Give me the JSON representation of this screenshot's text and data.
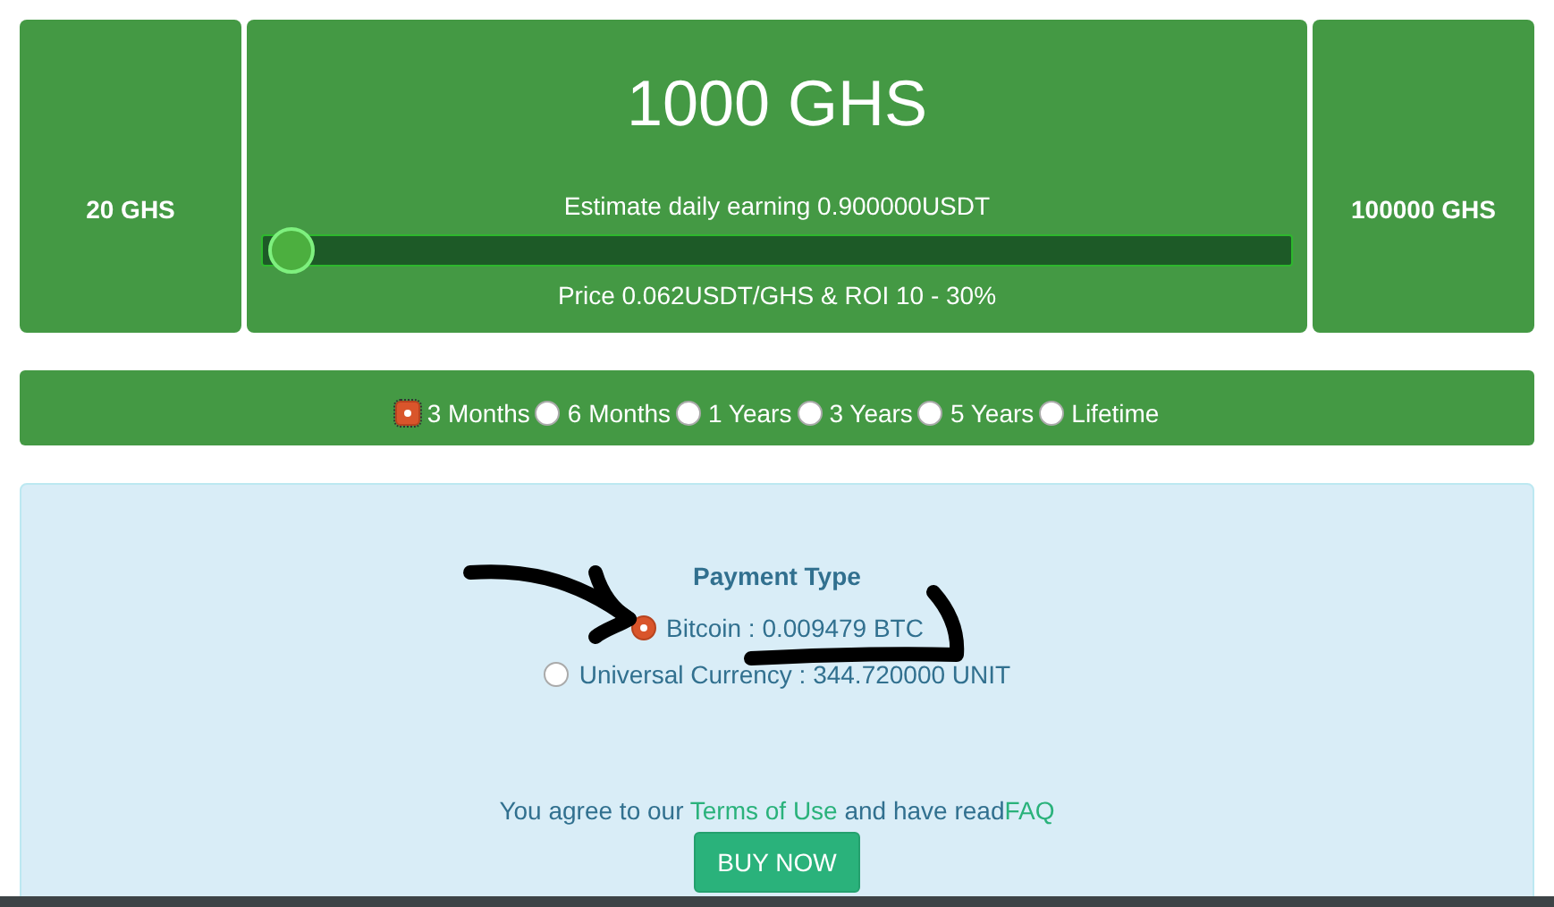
{
  "header": {
    "hashrate": "1000 GHS",
    "min": "20 GHS",
    "max": "100000 GHS",
    "estimate": "Estimate daily earning 0.900000USDT",
    "price": "Price 0.062USDT/GHS & ROI 10 - 30%",
    "slider": {
      "level": 0.01
    }
  },
  "periods": [
    {
      "label": "3 Months",
      "selected": true
    },
    {
      "label": "6 Months",
      "selected": false
    },
    {
      "label": "1 Years",
      "selected": false
    },
    {
      "label": "3 Years",
      "selected": false
    },
    {
      "label": "5 Years",
      "selected": false
    },
    {
      "label": "Lifetime",
      "selected": false
    }
  ],
  "payment": {
    "title": "Payment Type",
    "options": [
      {
        "label": "Bitcoin : 0.009479 BTC",
        "selected": true
      },
      {
        "label": "Universal Currency : 344.720000 UNIT",
        "selected": false
      }
    ]
  },
  "agreement": {
    "before": "You agree to our ",
    "terms_link": "Terms of Use",
    "middle": " and have read",
    "faq_link": "FAQ"
  },
  "buy_button": "BUY NOW"
}
